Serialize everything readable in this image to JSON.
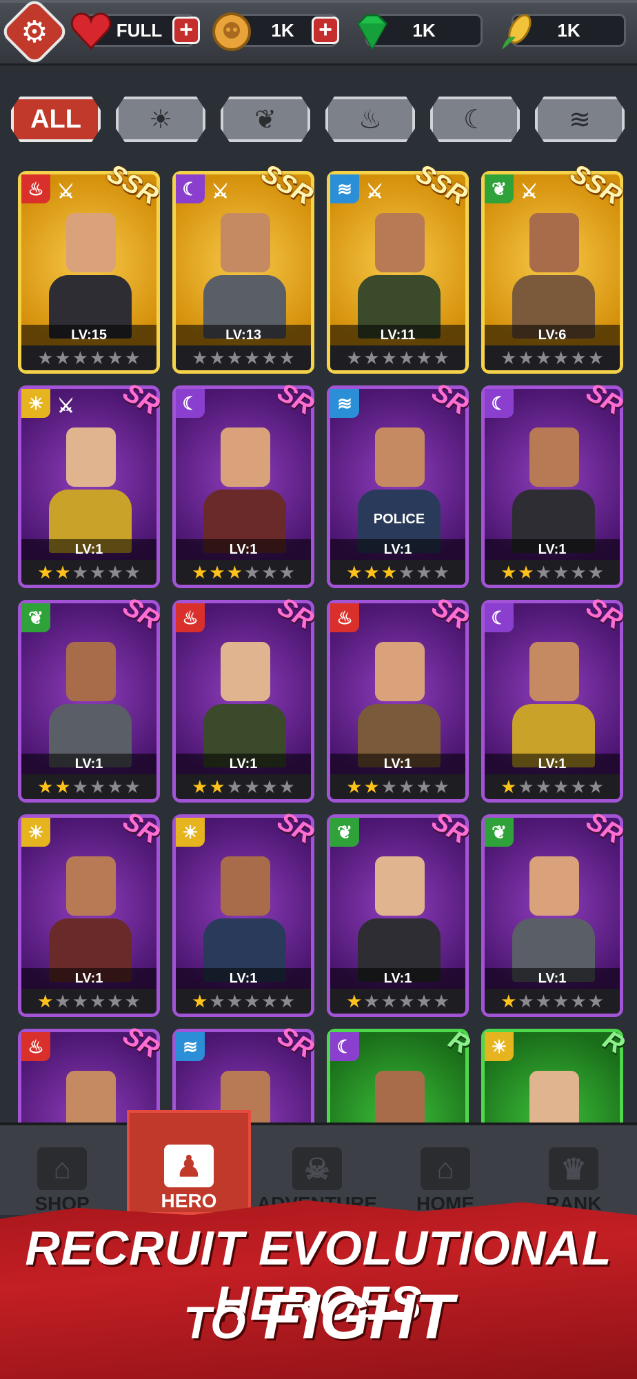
{
  "top_bar": {
    "resources": [
      {
        "name": "heart",
        "value": "FULL",
        "icon": "heart-icon",
        "has_plus": true
      },
      {
        "name": "coin",
        "value": "1K",
        "icon": "skull-coin-icon",
        "has_plus": true
      },
      {
        "name": "gem",
        "value": "1K",
        "icon": "gem-icon",
        "has_plus": false
      },
      {
        "name": "corn",
        "value": "1K",
        "icon": "corn-icon",
        "has_plus": false
      }
    ]
  },
  "filters": {
    "all_label": "ALL",
    "items": [
      "sun-icon",
      "leaf-icon",
      "fire-icon",
      "moon-icon",
      "water-icon"
    ]
  },
  "heroes": [
    {
      "rarity": "SSR",
      "element": "fire",
      "level": "LV:15",
      "stars": 0,
      "sword": true
    },
    {
      "rarity": "SSR",
      "element": "moon",
      "level": "LV:13",
      "stars": 0,
      "sword": true
    },
    {
      "rarity": "SSR",
      "element": "water",
      "level": "LV:11",
      "stars": 0,
      "sword": true
    },
    {
      "rarity": "SSR",
      "element": "leaf",
      "level": "LV:6",
      "stars": 0,
      "sword": true
    },
    {
      "rarity": "SR",
      "element": "sun",
      "level": "LV:1",
      "stars": 2,
      "sword": true
    },
    {
      "rarity": "SR",
      "element": "moon",
      "level": "LV:1",
      "stars": 3,
      "sword": false
    },
    {
      "rarity": "SR",
      "element": "water",
      "level": "LV:1",
      "stars": 3,
      "sword": false,
      "tag": "POLICE"
    },
    {
      "rarity": "SR",
      "element": "moon",
      "level": "LV:1",
      "stars": 2,
      "sword": false
    },
    {
      "rarity": "SR",
      "element": "leaf",
      "level": "LV:1",
      "stars": 2,
      "sword": false
    },
    {
      "rarity": "SR",
      "element": "fire",
      "level": "LV:1",
      "stars": 2,
      "sword": false
    },
    {
      "rarity": "SR",
      "element": "fire",
      "level": "LV:1",
      "stars": 2,
      "sword": false
    },
    {
      "rarity": "SR",
      "element": "moon",
      "level": "LV:1",
      "stars": 1,
      "sword": false
    },
    {
      "rarity": "SR",
      "element": "sun",
      "level": "LV:1",
      "stars": 1,
      "sword": false
    },
    {
      "rarity": "SR",
      "element": "sun",
      "level": "LV:1",
      "stars": 1,
      "sword": false
    },
    {
      "rarity": "SR",
      "element": "leaf",
      "level": "LV:1",
      "stars": 1,
      "sword": false
    },
    {
      "rarity": "SR",
      "element": "leaf",
      "level": "LV:1",
      "stars": 1,
      "sword": false
    },
    {
      "rarity": "SR",
      "element": "fire",
      "level": "",
      "stars": 0,
      "sword": false
    },
    {
      "rarity": "SR",
      "element": "water",
      "level": "",
      "stars": 0,
      "sword": false
    },
    {
      "rarity": "R",
      "element": "moon",
      "level": "",
      "stars": 0,
      "sword": false
    },
    {
      "rarity": "R",
      "element": "sun",
      "level": "",
      "stars": 0,
      "sword": false
    }
  ],
  "nav": {
    "items": [
      {
        "label": "SHOP",
        "icon": "shop-icon",
        "active": false
      },
      {
        "label": "HERO",
        "icon": "hero-cards-icon",
        "active": true
      },
      {
        "label": "ADVENTURE",
        "icon": "map-skull-icon",
        "active": false
      },
      {
        "label": "HOME",
        "icon": "home-icon",
        "active": false
      },
      {
        "label": "RANK",
        "icon": "trophy-icon",
        "active": false
      }
    ]
  },
  "banner": {
    "line1": "RECRUIT EVOLUTIONAL HEROES",
    "line2_small": "TO",
    "line2_big": "FIGHT"
  },
  "colors": {
    "accent_red": "#c0392b",
    "ssr_gold": "#f4d24a",
    "sr_purple": "#a354d6",
    "r_green": "#4ed84b",
    "star_on": "#ffc21a"
  }
}
